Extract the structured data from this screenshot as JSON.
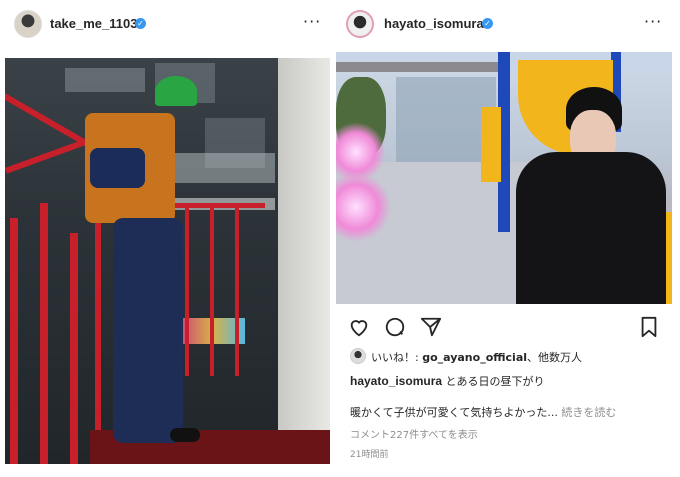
{
  "left_post": {
    "username": "take_me_1103",
    "verified": "✓",
    "more": "···"
  },
  "right_post": {
    "username": "hayato_isomura",
    "verified": "✓",
    "more": "···",
    "likes": {
      "prefix": "いいね！: ",
      "user": "go_ayano_official",
      "suffix": "、他数万人"
    },
    "caption": {
      "username": "hayato_isomura",
      "text": " とある日の昼下がり"
    },
    "body": "暖かくて子供が可愛くて気持ちよかった...",
    "more_link": " 続きを読む",
    "comments_link": "コメント227件すべてを表示",
    "timestamp": "21時間前"
  },
  "icons": {
    "heart": "heart-icon",
    "comment": "comment-icon",
    "share": "send-icon",
    "bookmark": "bookmark-icon"
  }
}
